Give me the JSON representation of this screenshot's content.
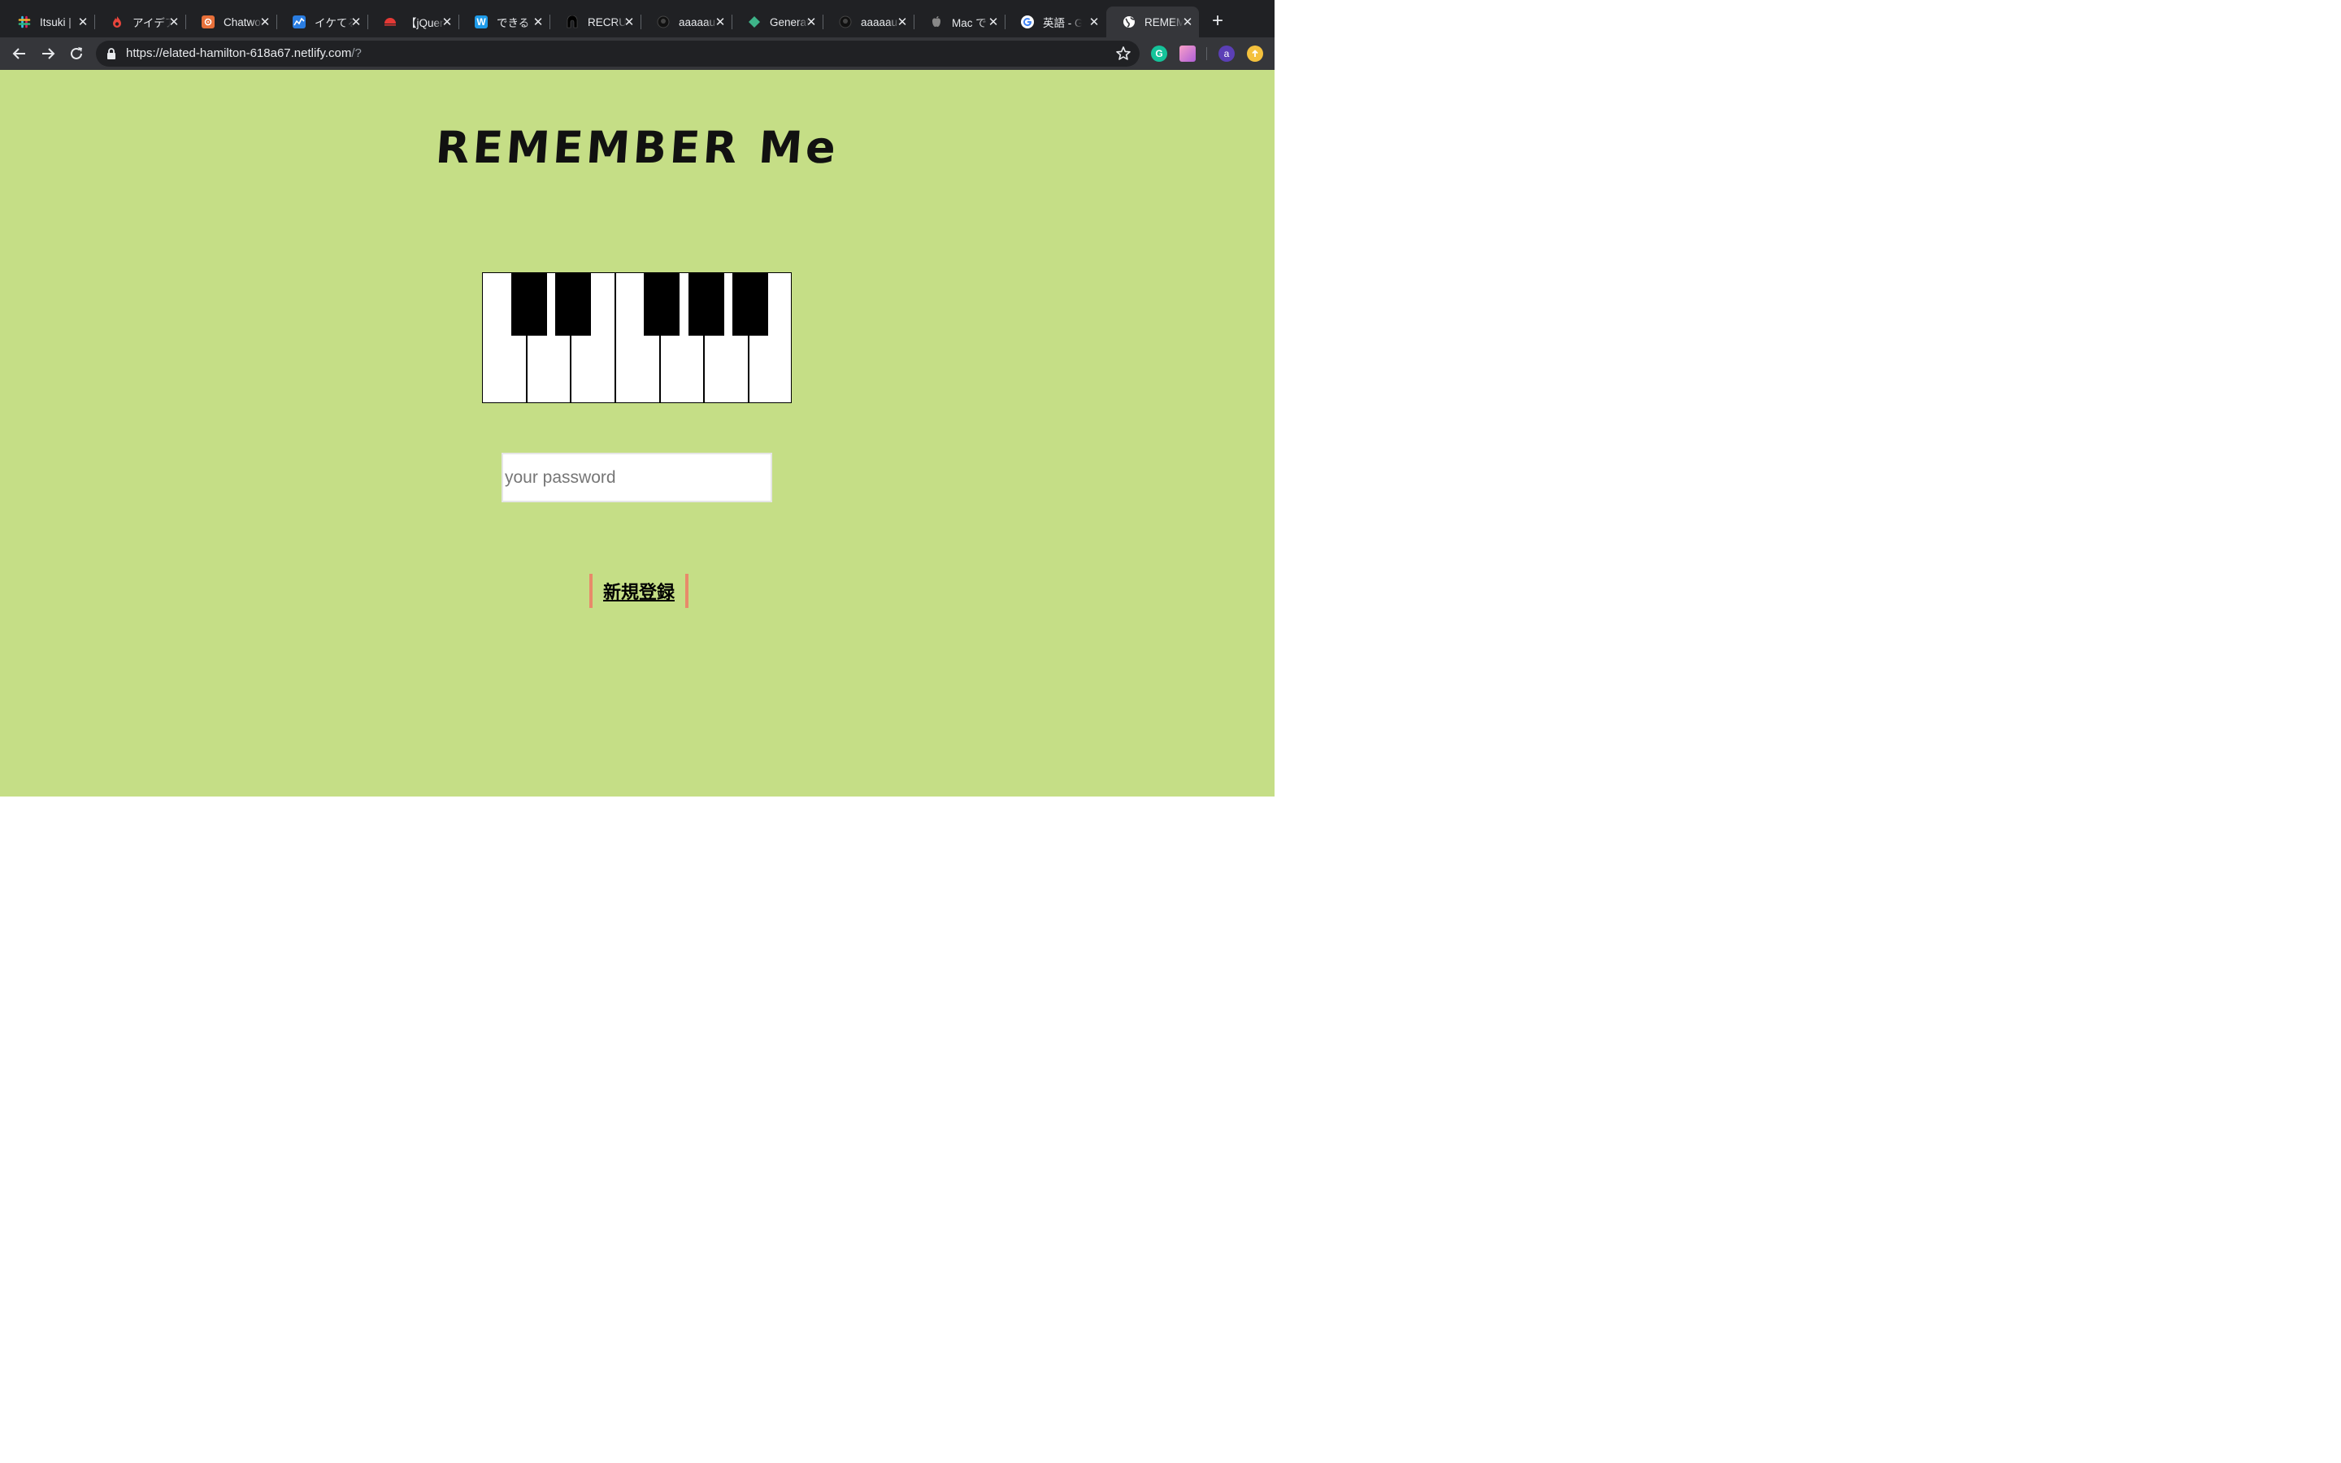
{
  "browser": {
    "tabs": [
      {
        "title": "Itsuki |",
        "favicon": "slack-icon",
        "color": "#4a154b"
      },
      {
        "title": "アイデア",
        "favicon": "flame-icon",
        "color": "#e8453c"
      },
      {
        "title": "Chatwork",
        "favicon": "chatwork-icon",
        "color": "#e8703a"
      },
      {
        "title": "イケてる",
        "favicon": "chart-icon",
        "color": "#1e88e5"
      },
      {
        "title": "【jQuery",
        "favicon": "sunrise-icon",
        "color": "#e53935"
      },
      {
        "title": "できる",
        "favicon": "w-icon",
        "color": "#1e9be9"
      },
      {
        "title": "RECRUIT",
        "favicon": "arch-icon",
        "color": "#000000"
      },
      {
        "title": "aaaaau",
        "favicon": "github-icon",
        "color": "#24292e"
      },
      {
        "title": "Generate",
        "favicon": "diamond-icon",
        "color": "#3eb489"
      },
      {
        "title": "aaaaau",
        "favicon": "github-icon",
        "color": "#24292e"
      },
      {
        "title": "Mac で",
        "favicon": "apple-icon",
        "color": "#888888"
      },
      {
        "title": "英語 - G",
        "favicon": "google-icon",
        "color": "#ffffff"
      },
      {
        "title": "REMEMBER",
        "favicon": "globe-icon",
        "color": "#ffffff",
        "active": true
      }
    ],
    "url_main": "https://elated-hamilton-618a67.netlify.com",
    "url_rest": "/?",
    "profile_initial": "a"
  },
  "page": {
    "title": "REMEMBER Me",
    "password_placeholder": "your password",
    "register_label": "新規登録",
    "background_color": "#c5de86",
    "button_border_color": "#e88a6a"
  },
  "piano": {
    "white_keys": 7,
    "black_keys": 5
  }
}
